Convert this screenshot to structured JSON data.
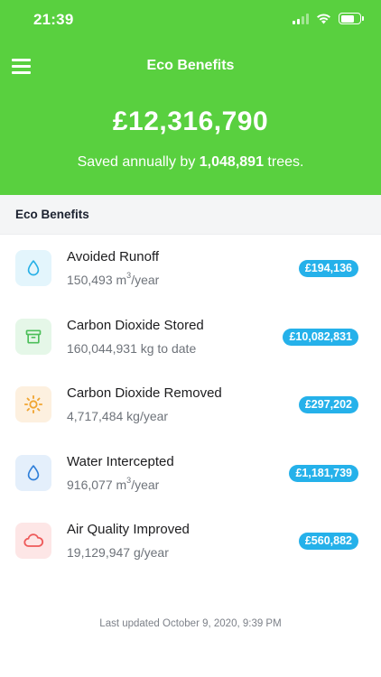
{
  "status": {
    "time": "21:39"
  },
  "header": {
    "title": "Eco Benefits",
    "total": "£12,316,790",
    "subtitle_prefix": "Saved annually by",
    "tree_count": "1,048,891",
    "subtitle_suffix": "trees."
  },
  "section": {
    "title": "Eco Benefits"
  },
  "benefits": [
    {
      "title": "Avoided Runoff",
      "amount": "150,493 m",
      "unit_sup": "3",
      "unit_suffix": "/year",
      "value": "£194,136",
      "icon": "droplet-icon",
      "icon_color": "#27b0e6",
      "icon_bg": "#e3f5fc"
    },
    {
      "title": "Carbon Dioxide Stored",
      "amount": "160,044,931 kg to date",
      "unit_sup": "",
      "unit_suffix": "",
      "value": "£10,082,831",
      "icon": "archive-box-icon",
      "icon_color": "#4cbf5a",
      "icon_bg": "#e5f7e8"
    },
    {
      "title": "Carbon Dioxide Removed",
      "amount": "4,717,484 kg/year",
      "unit_sup": "",
      "unit_suffix": "",
      "value": "£297,202",
      "icon": "sun-icon",
      "icon_color": "#f0a430",
      "icon_bg": "#fdf0df"
    },
    {
      "title": "Water Intercepted",
      "amount": "916,077 m",
      "unit_sup": "3",
      "unit_suffix": "/year",
      "value": "£1,181,739",
      "icon": "droplet-icon",
      "icon_color": "#2f7fd9",
      "icon_bg": "#e4effb"
    },
    {
      "title": "Air Quality Improved",
      "amount": "19,129,947 g/year",
      "unit_sup": "",
      "unit_suffix": "",
      "value": "£560,882",
      "icon": "cloud-icon",
      "icon_color": "#ee5a5a",
      "icon_bg": "#fde6e6"
    }
  ],
  "footer": {
    "last_updated": "Last updated October 9, 2020, 9:39 PM"
  },
  "colors": {
    "header_bg": "#59d03f",
    "badge_bg": "#25b1ea"
  }
}
